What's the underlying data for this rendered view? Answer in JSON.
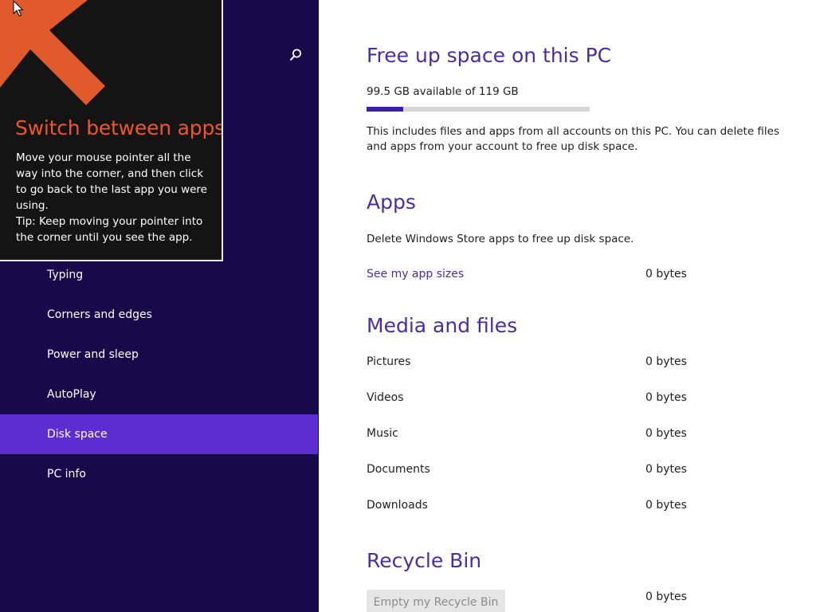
{
  "nav": {
    "items": [
      {
        "label": "Typing",
        "selected": false
      },
      {
        "label": "Corners and edges",
        "selected": false
      },
      {
        "label": "Power and sleep",
        "selected": false
      },
      {
        "label": "AutoPlay",
        "selected": false
      },
      {
        "label": "Disk space",
        "selected": true
      },
      {
        "label": "PC info",
        "selected": false
      }
    ],
    "search_icon": "search-icon"
  },
  "tip": {
    "title": "Switch between apps",
    "body": "Move your mouse pointer all the way into the corner, and then click to go back to the last app you were using.",
    "tip": "Tip: Keep moving your pointer into the corner until you see the app.",
    "arrow_icon": "arrow-up-left-icon"
  },
  "main": {
    "title": "Free up space on this PC",
    "storage": {
      "summary": "99.5 GB available of 119 GB",
      "used_fraction": 0.164
    },
    "description": "This includes files and apps from all accounts on this PC. You can delete files and apps from your account to free up disk space.",
    "apps": {
      "heading": "Apps",
      "description": "Delete Windows Store apps to free up disk space.",
      "link_label": "See my app sizes",
      "size": "0 bytes"
    },
    "media": {
      "heading": "Media and files",
      "rows": [
        {
          "label": "Pictures",
          "size": "0 bytes"
        },
        {
          "label": "Videos",
          "size": "0 bytes"
        },
        {
          "label": "Music",
          "size": "0 bytes"
        },
        {
          "label": "Documents",
          "size": "0 bytes"
        },
        {
          "label": "Downloads",
          "size": "0 bytes"
        }
      ]
    },
    "recycle_bin": {
      "heading": "Recycle Bin",
      "button_label": "Empty my Recycle Bin",
      "size": "0 bytes"
    }
  },
  "colors": {
    "nav_background": "#180a4a",
    "nav_selected": "#5c2ed1",
    "accent": "#4a2ea1",
    "tip_title": "#f0562a",
    "tip_background": "#141414"
  }
}
